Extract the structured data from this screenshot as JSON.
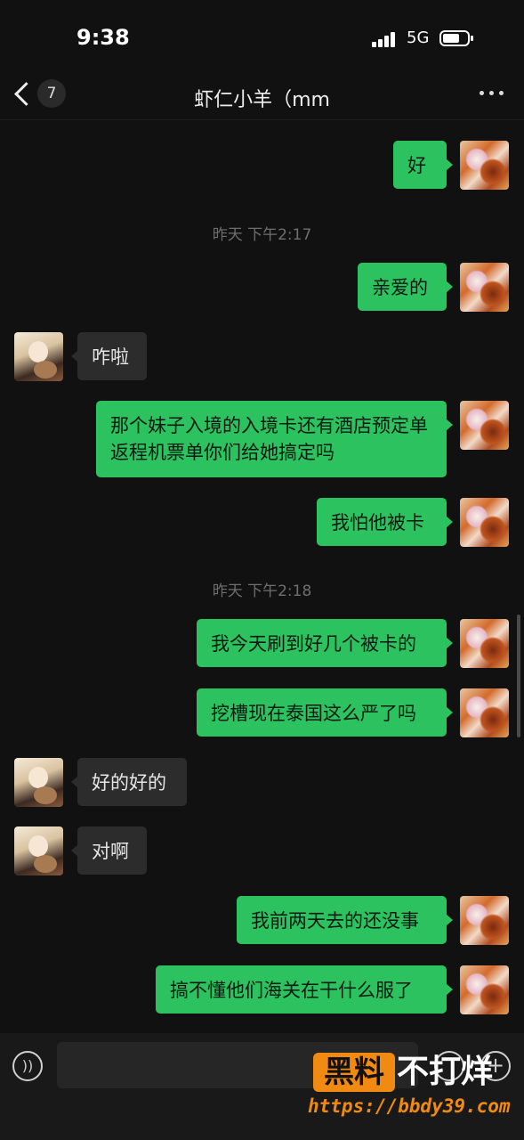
{
  "status": {
    "time": "9:38",
    "network": "5G"
  },
  "nav": {
    "badge": "7",
    "title": "虾仁小羊（mm"
  },
  "messages": {
    "m1": "好",
    "t1": "昨天 下午2:17",
    "m2": "亲爱的",
    "m3": "咋啦",
    "m4": "那个妹子入境的入境卡还有酒店预定单返程机票单你们给她搞定吗",
    "m5": "我怕他被卡",
    "t2": "昨天 下午2:18",
    "m6": "我今天刷到好几个被卡的",
    "m7": "挖槽现在泰国这么严了吗",
    "m8": "好的好的",
    "m9": "对啊",
    "m10": "我前两天去的还没事",
    "m11": "搞不懂他们海关在干什么服了"
  },
  "watermark": {
    "brand": "黑料",
    "text": "不打烊",
    "url": "https://bbdy39.com"
  }
}
